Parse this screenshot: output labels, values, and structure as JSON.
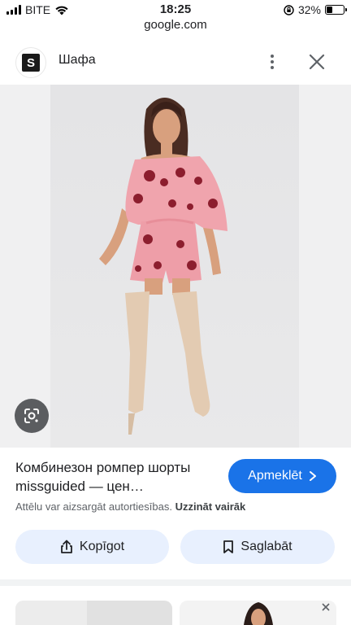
{
  "status_bar": {
    "carrier": "BITE",
    "time": "18:25",
    "battery": "32%",
    "battery_level": 0.32
  },
  "url": "google.com",
  "header": {
    "site_icon_letter": "S",
    "site_name": "Шафа",
    "more_icon": "more-vert-icon",
    "close_icon": "close-icon"
  },
  "image": {
    "lens_icon": "google-lens-icon"
  },
  "result": {
    "title": "Комбинезон ромпер шорты missguided — цен…",
    "visit_label": "Apmeklēt",
    "copyright_text": "Attēlu var aizsargāt autortiesības.",
    "learn_more": "Uzzināt vairāk"
  },
  "actions": {
    "share_label": "Kopīgot",
    "save_label": "Saglabāt"
  },
  "colors": {
    "accent": "#1a73e8",
    "action_bg": "#e8f0fe",
    "dress": "#f0a4ad",
    "flowers": "#8c1e2e",
    "boots": "#e3cbb2"
  }
}
